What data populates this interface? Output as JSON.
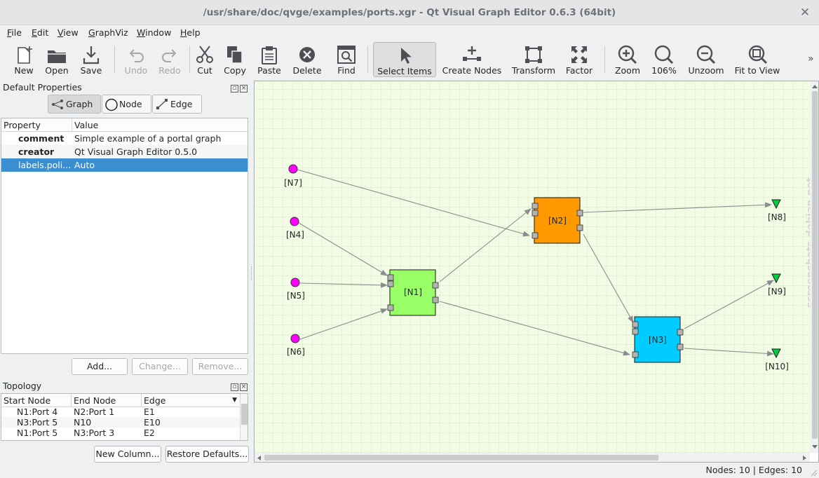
{
  "window": {
    "title": "/usr/share/doc/qvge/examples/ports.xgr - Qt Visual Graph Editor 0.6.3 (64bit)",
    "close_glyph": "✕"
  },
  "menu": [
    {
      "label": "File",
      "u": "F",
      "rest": "ile"
    },
    {
      "label": "Edit",
      "u": "E",
      "rest": "dit"
    },
    {
      "label": "View",
      "u": "V",
      "rest": "iew"
    },
    {
      "label": "GraphViz",
      "u": "G",
      "rest": "raphViz"
    },
    {
      "label": "Window",
      "u": "W",
      "rest": "indow"
    },
    {
      "label": "Help",
      "u": "H",
      "rest": "elp"
    }
  ],
  "toolbar": {
    "new": "New",
    "open": "Open",
    "save": "Save",
    "undo": "Undo",
    "redo": "Redo",
    "cut": "Cut",
    "copy": "Copy",
    "paste": "Paste",
    "delete": "Delete",
    "find": "Find",
    "select_items": "Select Items",
    "create_nodes": "Create Nodes",
    "transform": "Transform",
    "factor": "Factor",
    "zoom": "Zoom",
    "zoom_level": "106%",
    "unzoom": "Unzoom",
    "fit_to_view": "Fit to View",
    "overflow": "»"
  },
  "default_properties": {
    "title": "Default Properties",
    "tabs": {
      "graph": "Graph",
      "node": "Node",
      "edge": "Edge"
    },
    "columns": {
      "property": "Property",
      "value": "Value"
    },
    "rows": [
      {
        "property": "comment",
        "value": "Simple example of a portal graph"
      },
      {
        "property": "creator",
        "value": "Qt Visual Graph Editor 0.5.0"
      },
      {
        "property": "labels.poli...",
        "value": "Auto"
      }
    ],
    "buttons": {
      "add": "Add...",
      "change": "Change...",
      "remove": "Remove..."
    }
  },
  "topology": {
    "title": "Topology",
    "columns": {
      "start": "Start Node",
      "end": "End Node",
      "edge": "Edge"
    },
    "rows": [
      {
        "start": "N1:Port 4",
        "end": "N2:Port 1",
        "edge": "E1"
      },
      {
        "start": "N3:Port 5",
        "end": "N10",
        "edge": "E10"
      },
      {
        "start": "N1:Port 5",
        "end": "N3:Port 3",
        "edge": "E2"
      }
    ],
    "buttons": {
      "new_column": "New Column...",
      "restore_defaults": "Restore Defaults..."
    }
  },
  "graph": {
    "nodes": {
      "n1": "[N1]",
      "n2": "[N2]",
      "n3": "[N3]",
      "n4": "[N4]",
      "n5": "[N5]",
      "n6": "[N6]",
      "n7": "[N7]",
      "n8": "[N8]",
      "n9": "[N9]",
      "n10": "[N10]"
    },
    "colors": {
      "n1": "#99ff66",
      "n2": "#ff9900",
      "n3": "#00ccff",
      "source": "#ff00ff",
      "sink": "#00cc44",
      "grid_bg": "#f2fbe3"
    }
  },
  "status": {
    "text": "Nodes: 10 | Edges: 10"
  },
  "watermark": "screenshots.debian.net"
}
